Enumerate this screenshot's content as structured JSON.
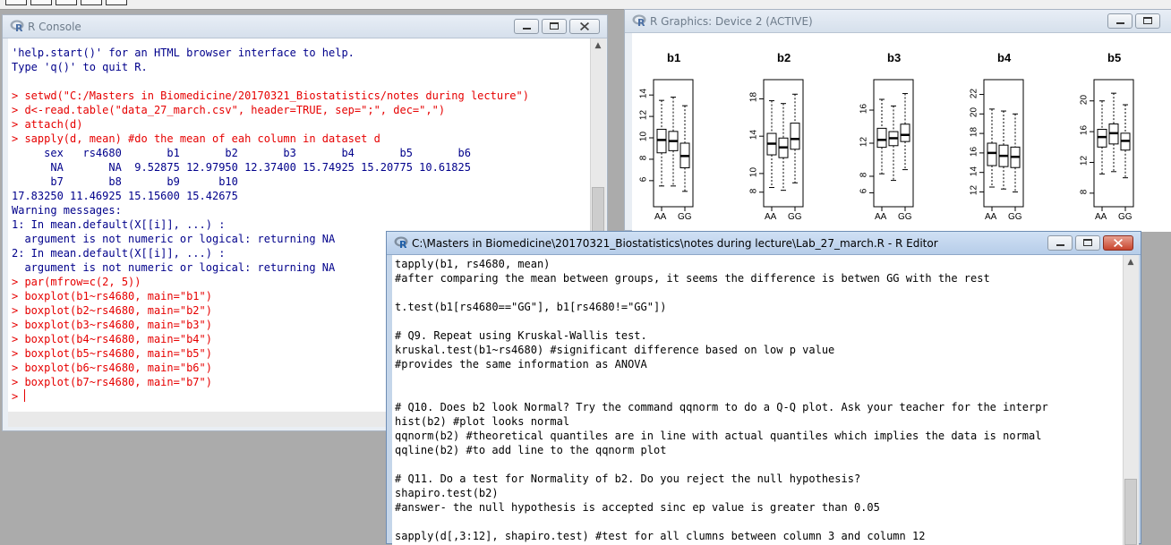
{
  "console": {
    "title": "R Console",
    "lines": [
      {
        "text": "'help.start()' for an HTML browser interface to help.",
        "kind": "out"
      },
      {
        "text": "Type 'q()' to quit R.",
        "kind": "out"
      },
      {
        "text": "",
        "kind": "out"
      },
      {
        "text": "> setwd(\"C:/Masters in Biomedicine/20170321_Biostatistics/notes during lecture\")",
        "kind": "cmd"
      },
      {
        "text": "> d<-read.table(\"data_27_march.csv\", header=TRUE, sep=\";\", dec=\",\")",
        "kind": "cmd"
      },
      {
        "text": "> attach(d)",
        "kind": "cmd"
      },
      {
        "text": "> sapply(d, mean) #do the mean of eah column in dataset d",
        "kind": "cmd"
      },
      {
        "text": "     sex   rs4680       b1       b2       b3       b4       b5       b6",
        "kind": "out"
      },
      {
        "text": "      NA       NA  9.52875 12.97950 12.37400 15.74925 15.20775 10.61825",
        "kind": "out"
      },
      {
        "text": "      b7       b8       b9      b10",
        "kind": "out"
      },
      {
        "text": "17.83250 11.46925 15.15600 15.42675",
        "kind": "out"
      },
      {
        "text": "Warning messages:",
        "kind": "out"
      },
      {
        "text": "1: In mean.default(X[[i]], ...) :",
        "kind": "out"
      },
      {
        "text": "  argument is not numeric or logical: returning NA",
        "kind": "out"
      },
      {
        "text": "2: In mean.default(X[[i]], ...) :",
        "kind": "out"
      },
      {
        "text": "  argument is not numeric or logical: returning NA",
        "kind": "out"
      },
      {
        "text": "> par(mfrow=c(2, 5))",
        "kind": "cmd"
      },
      {
        "text": "> boxplot(b1~rs4680, main=\"b1\")",
        "kind": "cmd"
      },
      {
        "text": "> boxplot(b2~rs4680, main=\"b2\")",
        "kind": "cmd"
      },
      {
        "text": "> boxplot(b3~rs4680, main=\"b3\")",
        "kind": "cmd"
      },
      {
        "text": "> boxplot(b4~rs4680, main=\"b4\")",
        "kind": "cmd"
      },
      {
        "text": "> boxplot(b5~rs4680, main=\"b5\")",
        "kind": "cmd"
      },
      {
        "text": "> boxplot(b6~rs4680, main=\"b6\")",
        "kind": "cmd"
      },
      {
        "text": "> boxplot(b7~rs4680, main=\"b7\")",
        "kind": "cmd"
      },
      {
        "text": "> ",
        "kind": "cmd"
      }
    ]
  },
  "graphics": {
    "title": "R Graphics: Device 2 (ACTIVE)"
  },
  "chart_data": [
    {
      "type": "boxplot",
      "title": "b1",
      "categories": [
        "AA",
        "GG"
      ],
      "yticks": [
        6,
        8,
        10,
        12,
        14
      ],
      "boxes": [
        [
          5.5,
          8.6,
          9.8,
          10.8,
          13.5
        ],
        [
          5.5,
          8.8,
          9.7,
          10.6,
          13.8
        ],
        [
          5.0,
          7.2,
          8.3,
          9.5,
          13.0
        ]
      ]
    },
    {
      "type": "boxplot",
      "title": "b2",
      "categories": [
        "AA",
        "GG"
      ],
      "yticks": [
        8,
        10,
        14,
        18
      ],
      "boxes": [
        [
          8.5,
          12.0,
          13.2,
          14.3,
          17.8
        ],
        [
          8.2,
          11.7,
          12.8,
          13.8,
          17.5
        ],
        [
          9.0,
          12.6,
          13.7,
          15.4,
          18.5
        ]
      ]
    },
    {
      "type": "boxplot",
      "title": "b3",
      "categories": [
        "AA",
        "GG"
      ],
      "yticks": [
        6,
        8,
        12,
        16
      ],
      "boxes": [
        [
          8.3,
          11.5,
          12.4,
          13.8,
          17.3
        ],
        [
          7.5,
          11.7,
          12.6,
          13.4,
          16.5
        ],
        [
          8.8,
          12.2,
          13.0,
          14.3,
          18.0
        ]
      ]
    },
    {
      "type": "boxplot",
      "title": "b4",
      "categories": [
        "AA",
        "GG"
      ],
      "yticks": [
        12,
        14,
        16,
        18,
        20,
        22
      ],
      "boxes": [
        [
          12.5,
          14.7,
          16.0,
          17.0,
          20.5
        ],
        [
          12.3,
          14.6,
          15.7,
          16.8,
          20.3
        ],
        [
          12.0,
          14.5,
          15.6,
          16.6,
          20.0
        ]
      ]
    },
    {
      "type": "boxplot",
      "title": "b5",
      "categories": [
        "AA",
        "GG"
      ],
      "yticks": [
        8,
        12,
        16,
        20
      ],
      "boxes": [
        [
          10.5,
          14.0,
          15.3,
          16.3,
          20.0
        ],
        [
          10.8,
          14.4,
          15.8,
          17.0,
          21.0
        ],
        [
          10.0,
          13.6,
          14.8,
          15.8,
          19.5
        ]
      ]
    }
  ],
  "editor": {
    "title": "C:\\Masters in Biomedicine\\20170321_Biostatistics\\notes during lecture\\Lab_27_march.R - R Editor",
    "lines": [
      "tapply(b1, rs4680, mean)",
      "#after comparing the mean between groups, it seems the difference is betwen GG with the rest",
      "",
      "t.test(b1[rs4680==\"GG\"], b1[rs4680!=\"GG\"])",
      "",
      "# Q9. Repeat using Kruskal-Wallis test.",
      "kruskal.test(b1~rs4680) #significant difference based on low p value",
      "#provides the same information as ANOVA",
      "",
      "",
      "# Q10. Does b2 look Normal? Try the command qqnorm to do a Q-Q plot. Ask your teacher for the interpr",
      "hist(b2) #plot looks normal",
      "qqnorm(b2) #theoretical quantiles are in line with actual quantiles which implies the data is normal",
      "qqline(b2) #to add line to the qqnorm plot",
      "",
      "# Q11. Do a test for Normality of b2. Do you reject the null hypothesis?",
      "shapiro.test(b2)",
      "#answer- the null hypothesis is accepted sinc ep value is greater than 0.05",
      "",
      "sapply(d[,3:12], shapiro.test) #test for all clumns between column 3 and column 12"
    ]
  }
}
